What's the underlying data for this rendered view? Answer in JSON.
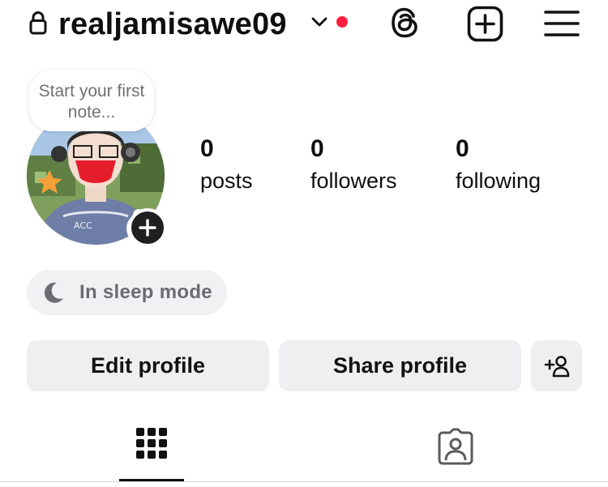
{
  "header": {
    "username": "realjamisawe09",
    "icons": {
      "lock": "lock-icon",
      "dropdown": "chevron-down-icon",
      "threads": "threads-icon",
      "create": "plus-square-icon",
      "menu": "hamburger-menu-icon"
    },
    "notification_dot_color": "#ff1f3d"
  },
  "note": {
    "placeholder": "Start your first note..."
  },
  "stats": [
    {
      "value": "0",
      "label": "posts"
    },
    {
      "value": "0",
      "label": "followers"
    },
    {
      "value": "0",
      "label": "following"
    }
  ],
  "status": {
    "label": "In sleep mode",
    "icon": "moon-icon"
  },
  "actions": {
    "edit_label": "Edit profile",
    "share_label": "Share profile",
    "discover_icon": "add-person-icon"
  },
  "tabs": [
    {
      "icon": "grid-icon",
      "selected": true
    },
    {
      "icon": "tagged-person-icon",
      "selected": false
    }
  ]
}
